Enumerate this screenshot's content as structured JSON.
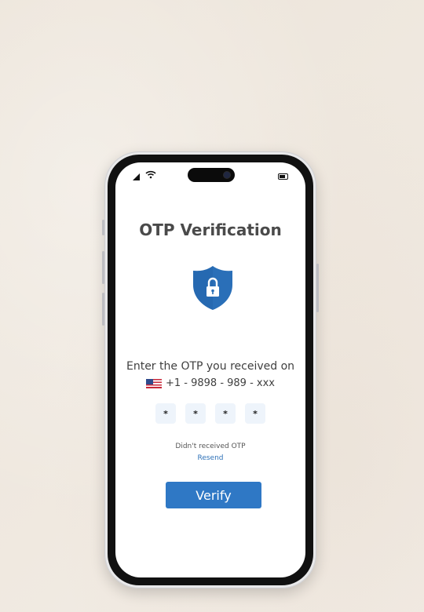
{
  "screen": {
    "title": "OTP Verification",
    "instruction": "Enter the OTP you received on",
    "phone_number": "+1 - 9898 - 989 - xxx",
    "country_flag": "us-flag-icon",
    "otp_digits": [
      "*",
      "*",
      "*",
      "*"
    ],
    "didnt_receive": "Didn't received OTP",
    "resend_label": "Resend",
    "verify_label": "Verify"
  },
  "status_bar": {
    "icons": [
      "signal-icon",
      "wifi-icon",
      "battery-icon"
    ]
  },
  "colors": {
    "accent": "#2f78c5",
    "shield": "#2a6fb8",
    "otp_box_bg": "#eef4fb",
    "title_text": "#4a4a4a"
  }
}
